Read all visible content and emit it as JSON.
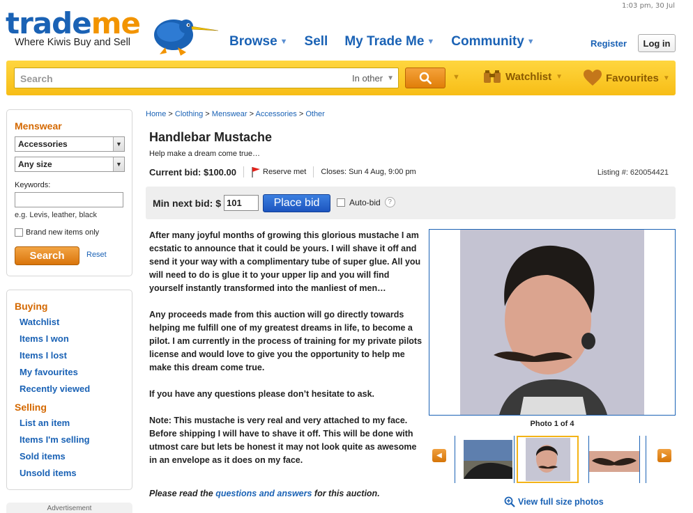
{
  "header": {
    "time": "1:03 pm, 30 Jul",
    "logo_trade": "trade",
    "logo_me": "me",
    "tagline": "Where Kiwis Buy and Sell",
    "nav": [
      {
        "label": "Browse",
        "has_menu": true
      },
      {
        "label": "Sell",
        "has_menu": false
      },
      {
        "label": "My Trade Me",
        "has_menu": true
      },
      {
        "label": "Community",
        "has_menu": true
      }
    ],
    "register": "Register",
    "login": "Log in"
  },
  "searchbar": {
    "placeholder": "Search",
    "scope": "In other",
    "watchlist": "Watchlist",
    "favourites": "Favourites",
    "colors": {
      "bar": "#f7c21f",
      "button": "#e8870f"
    }
  },
  "sidebar": {
    "category_title": "Menswear",
    "category_select": "Accessories",
    "size_select": "Any size",
    "keywords_label": "Keywords:",
    "keywords_hint": "e.g. Levis, leather, black",
    "brand_new_label": "Brand new items only",
    "search_button": "Search",
    "reset": "Reset",
    "buying_title": "Buying",
    "buying_links": [
      "Watchlist",
      "Items I won",
      "Items I lost",
      "My favourites",
      "Recently viewed"
    ],
    "selling_title": "Selling",
    "selling_links": [
      "List an item",
      "Items I'm selling",
      "Sold items",
      "Unsold items"
    ],
    "advertisement": "Advertisement"
  },
  "breadcrumb": [
    "Home",
    "Clothing",
    "Menswear",
    "Accessories",
    "Other"
  ],
  "listing": {
    "title": "Handlebar Mustache",
    "subtitle": "Help make a dream come true…",
    "current_bid_label": "Current bid: $100.00",
    "reserve": "Reserve met",
    "closes": "Closes: Sun 4 Aug, 9:00 pm",
    "listing_number": "Listing #: 620054421",
    "min_next_bid_label": "Min next bid:",
    "currency": "$",
    "min_next_bid_value": "101",
    "place_bid": "Place bid",
    "auto_bid": "Auto-bid",
    "help": "?",
    "description": [
      "After many joyful months of growing this glorious mustache I am ecstatic to announce that it could be yours. I will shave it off and send it your way with a complimentary tube of super glue. All you will need to do is glue it to your upper lip and you will find yourself instantly transformed into the manliest of men…",
      "Any proceeds made from this auction will go directly towards helping me fulfill one of my greatest dreams in life, to become a pilot. I am currently in the process of training for my private pilots license and would love to give you the opportunity to help me make this dream come true.",
      "If you have any questions please don’t hesitate to ask.",
      "Note: This mustache is very real and very attached to my face. Before shipping I will have to shave it off. This will be done with utmost care but lets be honest it may not look quite as awesome in an envelope as it does on my face."
    ],
    "note_prefix": "Please read the ",
    "note_link": "questions and answers",
    "note_suffix": " for this auction.",
    "photo_caption": "Photo 1 of 4",
    "view_full_size": "View full size photos"
  }
}
